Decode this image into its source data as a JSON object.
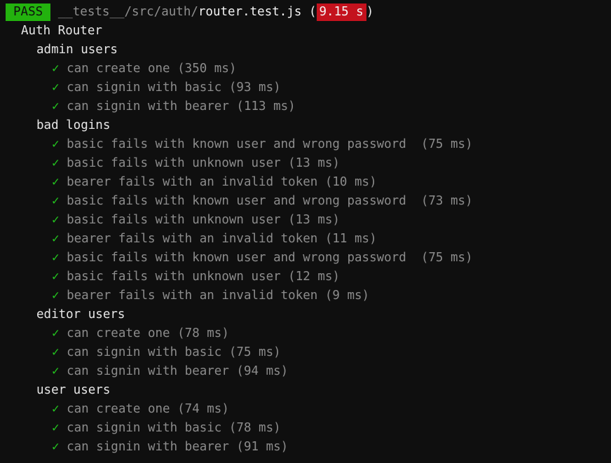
{
  "header": {
    "status": "PASS",
    "path_dim": "__tests__/src/auth/",
    "file": "router.test.js",
    "open_paren": "(",
    "time": "9.15 s",
    "close_paren": ")"
  },
  "suite": {
    "name": "Auth Router"
  },
  "check_glyph": "✓",
  "groups": [
    {
      "name": "admin users",
      "tests": [
        "can create one (350 ms)",
        "can signin with basic (93 ms)",
        "can signin with bearer (113 ms)"
      ]
    },
    {
      "name": "bad logins",
      "tests": [
        "basic fails with known user and wrong password  (75 ms)",
        "basic fails with unknown user (13 ms)",
        "bearer fails with an invalid token (10 ms)",
        "basic fails with known user and wrong password  (73 ms)",
        "basic fails with unknown user (13 ms)",
        "bearer fails with an invalid token (11 ms)",
        "basic fails with known user and wrong password  (75 ms)",
        "basic fails with unknown user (12 ms)",
        "bearer fails with an invalid token (9 ms)"
      ]
    },
    {
      "name": "editor users",
      "tests": [
        "can create one (78 ms)",
        "can signin with basic (75 ms)",
        "can signin with bearer (94 ms)"
      ]
    },
    {
      "name": "user users",
      "tests": [
        "can create one (74 ms)",
        "can signin with basic (78 ms)",
        "can signin with bearer (91 ms)"
      ]
    }
  ],
  "colors": {
    "background": "#0f0f0f",
    "pass_badge": "#23b20e",
    "time_badge": "#c4121d",
    "check": "#23c41f"
  }
}
